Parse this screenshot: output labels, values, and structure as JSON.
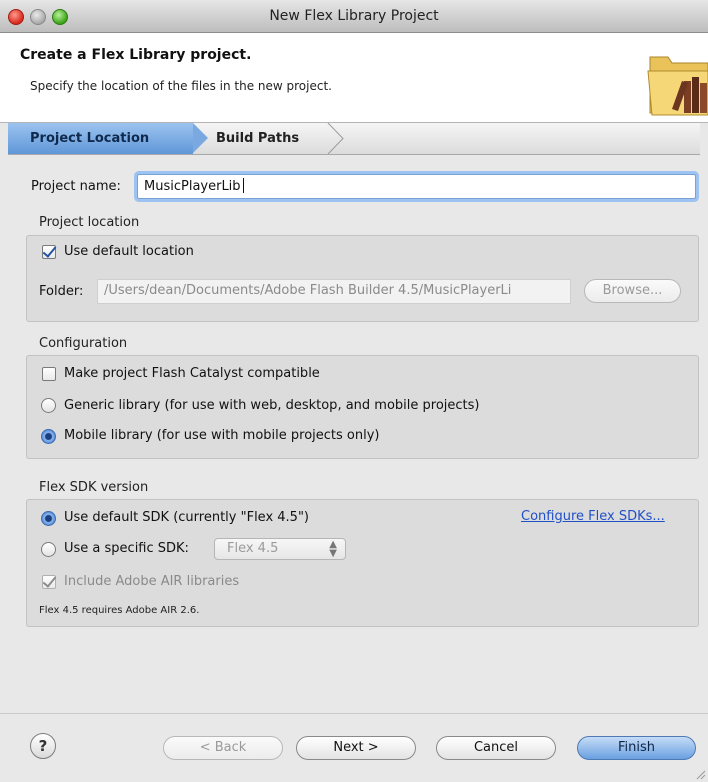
{
  "window": {
    "title": "New Flex Library Project"
  },
  "header": {
    "title": "Create a Flex Library project.",
    "subtitle": "Specify the location of the files in the new project.",
    "icon": "folder-books-icon"
  },
  "tabs": [
    {
      "label": "Project Location",
      "active": true
    },
    {
      "label": "Build Paths",
      "active": false
    }
  ],
  "form": {
    "project_name_label": "Project name:",
    "project_name_value": "MusicPlayerLib"
  },
  "location": {
    "title": "Project location",
    "use_default_label": "Use default location",
    "use_default_checked": true,
    "folder_label": "Folder:",
    "folder_value": "/Users/dean/Documents/Adobe Flash Builder 4.5/MusicPlayerLi",
    "browse_label": "Browse..."
  },
  "configuration": {
    "title": "Configuration",
    "catalyst_label": "Make project Flash Catalyst compatible",
    "catalyst_checked": false,
    "generic_label": "Generic library (for use with web, desktop, and mobile projects)",
    "mobile_label": "Mobile library (for use with mobile projects only)",
    "selected": "mobile"
  },
  "sdk": {
    "title": "Flex SDK version",
    "default_label": "Use default SDK (currently \"Flex 4.5\")",
    "configure_link": "Configure Flex SDKs...",
    "specific_label": "Use a specific SDK:",
    "specific_value": "Flex 4.5",
    "air_label": "Include Adobe AIR libraries",
    "air_checked": true,
    "note": "Flex 4.5 requires Adobe AIR 2.6.",
    "selected": "default"
  },
  "footer": {
    "help_label": "?",
    "back_label": "< Back",
    "next_label": "Next >",
    "cancel_label": "Cancel",
    "finish_label": "Finish"
  },
  "colors": {
    "accent": "#5f97d8",
    "link": "#2050c8"
  }
}
